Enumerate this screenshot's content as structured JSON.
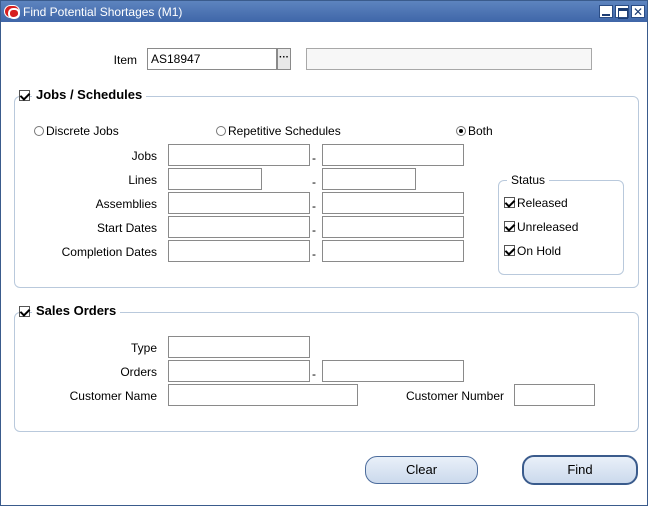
{
  "window": {
    "title": "Find Potential Shortages (M1)"
  },
  "item": {
    "label": "Item",
    "value": "AS18947",
    "description": ""
  },
  "jobs_group": {
    "title": "Jobs / Schedules",
    "checked": true,
    "radios": [
      {
        "label": "Discrete Jobs",
        "selected": false
      },
      {
        "label": "Repetitive Schedules",
        "selected": false
      },
      {
        "label": "Both",
        "selected": true
      }
    ],
    "ranges": [
      {
        "label": "Jobs",
        "from": "",
        "to": ""
      },
      {
        "label": "Lines",
        "from": "",
        "to": ""
      },
      {
        "label": "Assemblies",
        "from": "",
        "to": ""
      },
      {
        "label": "Start Dates",
        "from": "",
        "to": ""
      },
      {
        "label": "Completion Dates",
        "from": "",
        "to": ""
      }
    ],
    "range_separator": "-",
    "status": {
      "title": "Status",
      "options": [
        {
          "label": "Released",
          "checked": true
        },
        {
          "label": "Unreleased",
          "checked": true
        },
        {
          "label": "On Hold",
          "checked": true
        }
      ]
    }
  },
  "sales_group": {
    "title": "Sales Orders",
    "checked": true,
    "type_label": "Type",
    "type_value": "",
    "orders_label": "Orders",
    "orders_from": "",
    "orders_to": "",
    "range_separator": "-",
    "customer_name_label": "Customer Name",
    "customer_name_value": "",
    "customer_number_label": "Customer Number",
    "customer_number_value": ""
  },
  "buttons": {
    "clear": "Clear",
    "find": "Find"
  },
  "colors": {
    "titlebar": "#4a72b4",
    "group_border": "#b9c9dc",
    "button_fill": "#d6e2f1"
  }
}
